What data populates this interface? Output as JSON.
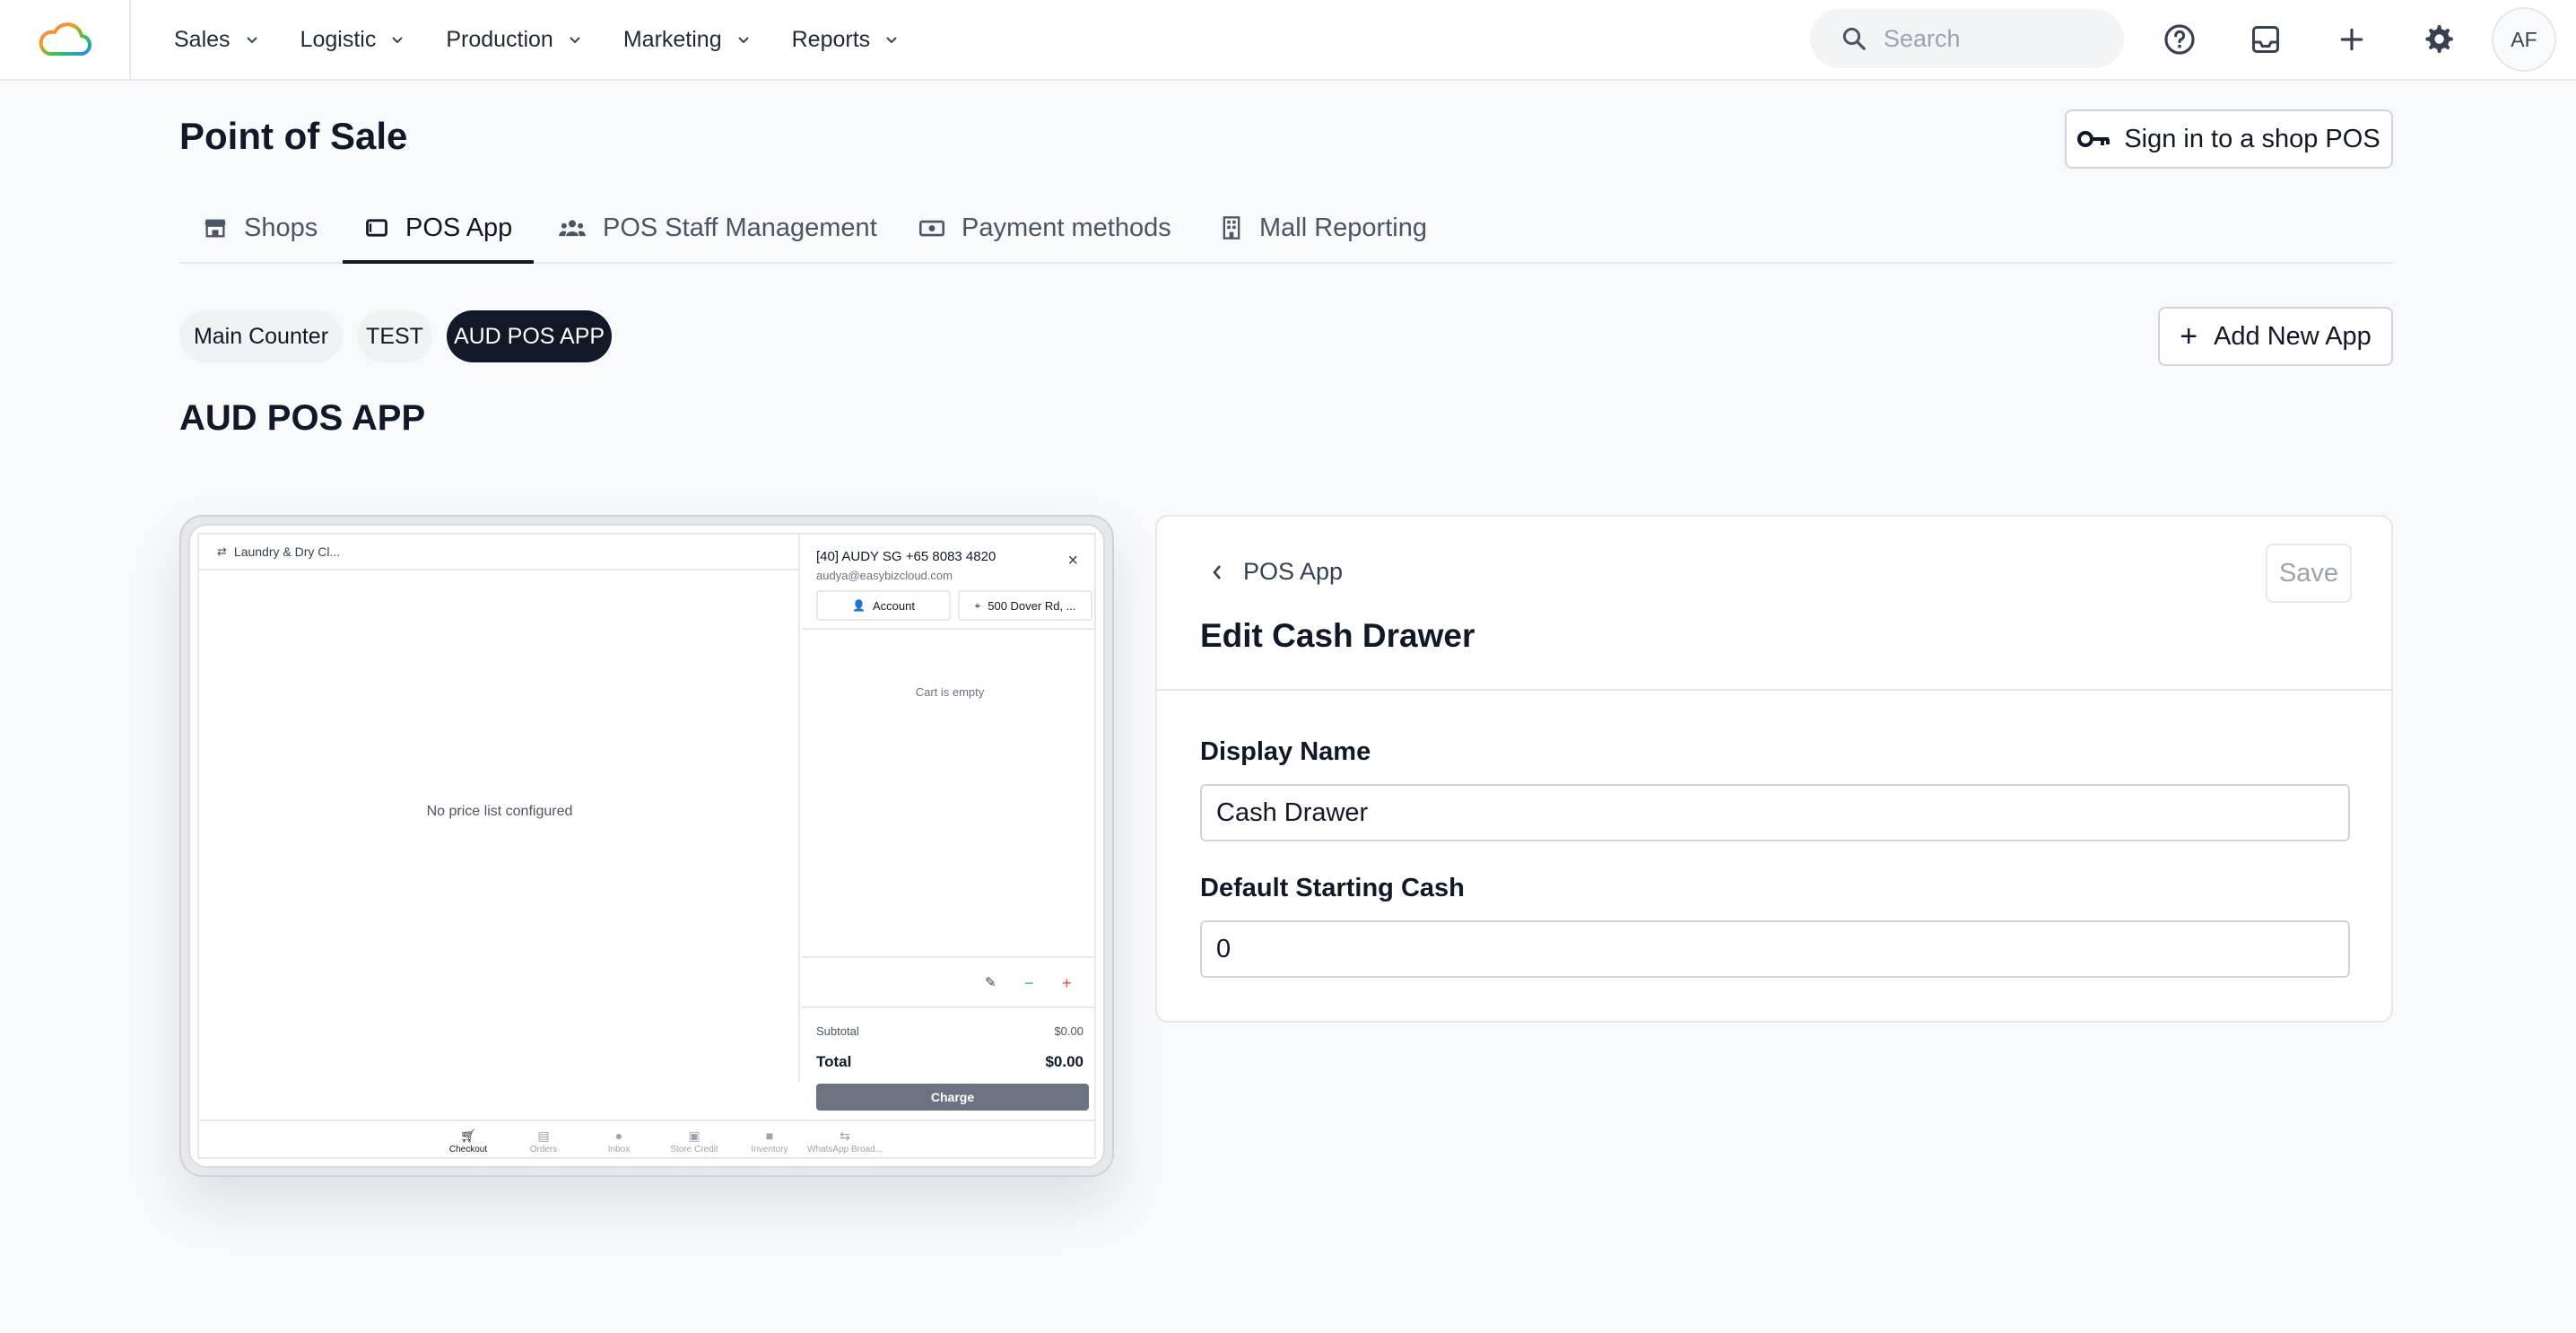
{
  "nav": {
    "items": [
      {
        "label": "Sales"
      },
      {
        "label": "Logistic"
      },
      {
        "label": "Production"
      },
      {
        "label": "Marketing"
      },
      {
        "label": "Reports"
      }
    ],
    "search_placeholder": "Search",
    "avatar_initials": "AF"
  },
  "header": {
    "title": "Point of Sale",
    "signin_label": "Sign in to a shop POS"
  },
  "tabs": [
    {
      "label": "Shops",
      "icon": "store-icon"
    },
    {
      "label": "POS App",
      "icon": "tablet-icon",
      "active": true
    },
    {
      "label": "POS Staff Management",
      "icon": "users-icon"
    },
    {
      "label": "Payment methods",
      "icon": "cash-icon"
    },
    {
      "label": "Mall Reporting",
      "icon": "building-icon"
    }
  ],
  "apps": {
    "pills": [
      {
        "label": "Main Counter"
      },
      {
        "label": "TEST"
      },
      {
        "label": "AUD POS APP",
        "active": true
      }
    ],
    "add_label": "Add New App",
    "section_title": "AUD POS APP"
  },
  "preview": {
    "shop_name": "Laundry & Dry Cl...",
    "empty_price_list": "No price list configured",
    "customer_line": "[40] AUDY SG +65 8083 4820",
    "customer_email": "audya@easybizcloud.com",
    "account_label": "Account",
    "address_label": "500 Dover Rd, ...",
    "cart_empty": "Cart is empty",
    "subtotal_label": "Subtotal",
    "subtotal_value": "$0.00",
    "total_label": "Total",
    "total_value": "$0.00",
    "charge_label": "Charge",
    "bottom_nav": [
      {
        "label": "Checkout",
        "active": true
      },
      {
        "label": "Orders"
      },
      {
        "label": "Inbox"
      },
      {
        "label": "Store Credit"
      },
      {
        "label": "Inventory"
      },
      {
        "label": "WhatsApp Broad..."
      }
    ]
  },
  "edit": {
    "back_label": "POS App",
    "title": "Edit Cash Drawer",
    "save_label": "Save",
    "display_name_label": "Display Name",
    "display_name_value": "Cash Drawer",
    "starting_cash_label": "Default Starting Cash",
    "starting_cash_value": "0"
  },
  "colors": {
    "primary": "#111827",
    "accent_plus": "#ef4444",
    "accent_minus": "#10b981"
  }
}
